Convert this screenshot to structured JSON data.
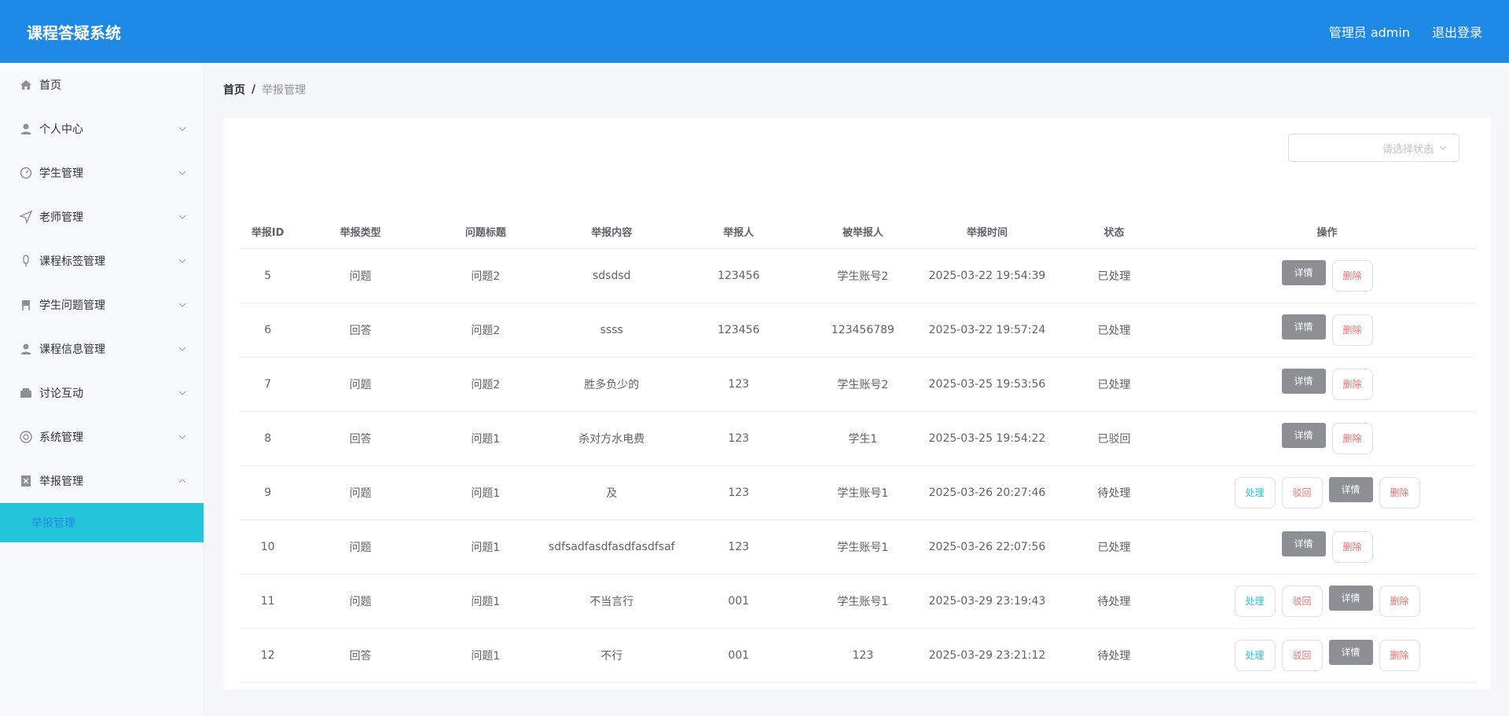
{
  "header": {
    "title": "课程答疑系统",
    "user": "管理员 admin",
    "logout": "退出登录"
  },
  "sidebar": {
    "items": [
      {
        "label": "首页",
        "icon": "home-icon",
        "expandable": false
      },
      {
        "label": "个人中心",
        "icon": "user-icon",
        "expandable": true
      },
      {
        "label": "学生管理",
        "icon": "dashboard-icon",
        "expandable": true
      },
      {
        "label": "老师管理",
        "icon": "send-icon",
        "expandable": true
      },
      {
        "label": "课程标签管理",
        "icon": "microphone-icon",
        "expandable": true
      },
      {
        "label": "学生问题管理",
        "icon": "chair-icon",
        "expandable": true
      },
      {
        "label": "课程信息管理",
        "icon": "user-icon",
        "expandable": true
      },
      {
        "label": "讨论互动",
        "icon": "wallet-icon",
        "expandable": true
      },
      {
        "label": "系统管理",
        "icon": "lifebuoy-icon",
        "expandable": true
      },
      {
        "label": "举报管理",
        "icon": "report-icon",
        "expandable": true,
        "open": true
      }
    ],
    "subitem": "举报管理"
  },
  "breadcrumb": {
    "home": "首页",
    "sep": "/",
    "current": "举报管理"
  },
  "filter": {
    "placeholder": "请选择状态"
  },
  "table": {
    "columns": [
      "举报ID",
      "举报类型",
      "问题标题",
      "举报内容",
      "举报人",
      "被举报人",
      "举报时间",
      "状态",
      "操作"
    ],
    "rows": [
      {
        "id": "5",
        "type": "问题",
        "title": "问题2",
        "content": "sdsdsd",
        "reporter": "123456",
        "reported": "学生账号2",
        "time": "2025-03-22 19:54:39",
        "status": "已处理",
        "pending": false
      },
      {
        "id": "6",
        "type": "回答",
        "title": "问题2",
        "content": "ssss",
        "reporter": "123456",
        "reported": "123456789",
        "time": "2025-03-22 19:57:24",
        "status": "已处理",
        "pending": false
      },
      {
        "id": "7",
        "type": "问题",
        "title": "问题2",
        "content": "胜多负少的",
        "reporter": "123",
        "reported": "学生账号2",
        "time": "2025-03-25 19:53:56",
        "status": "已处理",
        "pending": false
      },
      {
        "id": "8",
        "type": "回答",
        "title": "问题1",
        "content": "杀对方水电费",
        "reporter": "123",
        "reported": "学生1",
        "time": "2025-03-25 19:54:22",
        "status": "已驳回",
        "pending": false
      },
      {
        "id": "9",
        "type": "问题",
        "title": "问题1",
        "content": "及",
        "reporter": "123",
        "reported": "学生账号1",
        "time": "2025-03-26 20:27:46",
        "status": "待处理",
        "pending": true
      },
      {
        "id": "10",
        "type": "问题",
        "title": "问题1",
        "content": "sdfsadfasdfasdfasdfsaf",
        "reporter": "123",
        "reported": "学生账号1",
        "time": "2025-03-26 22:07:56",
        "status": "已处理",
        "pending": false
      },
      {
        "id": "11",
        "type": "问题",
        "title": "问题1",
        "content": "不当言行",
        "reporter": "001",
        "reported": "学生账号1",
        "time": "2025-03-29 23:19:43",
        "status": "待处理",
        "pending": true
      },
      {
        "id": "12",
        "type": "回答",
        "title": "问题1",
        "content": "不行",
        "reporter": "001",
        "reported": "123",
        "time": "2025-03-29 23:21:12",
        "status": "待处理",
        "pending": true
      }
    ],
    "buttons": {
      "handle": "处理",
      "reject": "驳回",
      "detail": "详情",
      "delete": "删除"
    }
  },
  "colors": {
    "header": "#1e88e5",
    "active_submenu": "#26c6da",
    "detail_button": "#8c8f94",
    "danger": "#f56c6c"
  }
}
